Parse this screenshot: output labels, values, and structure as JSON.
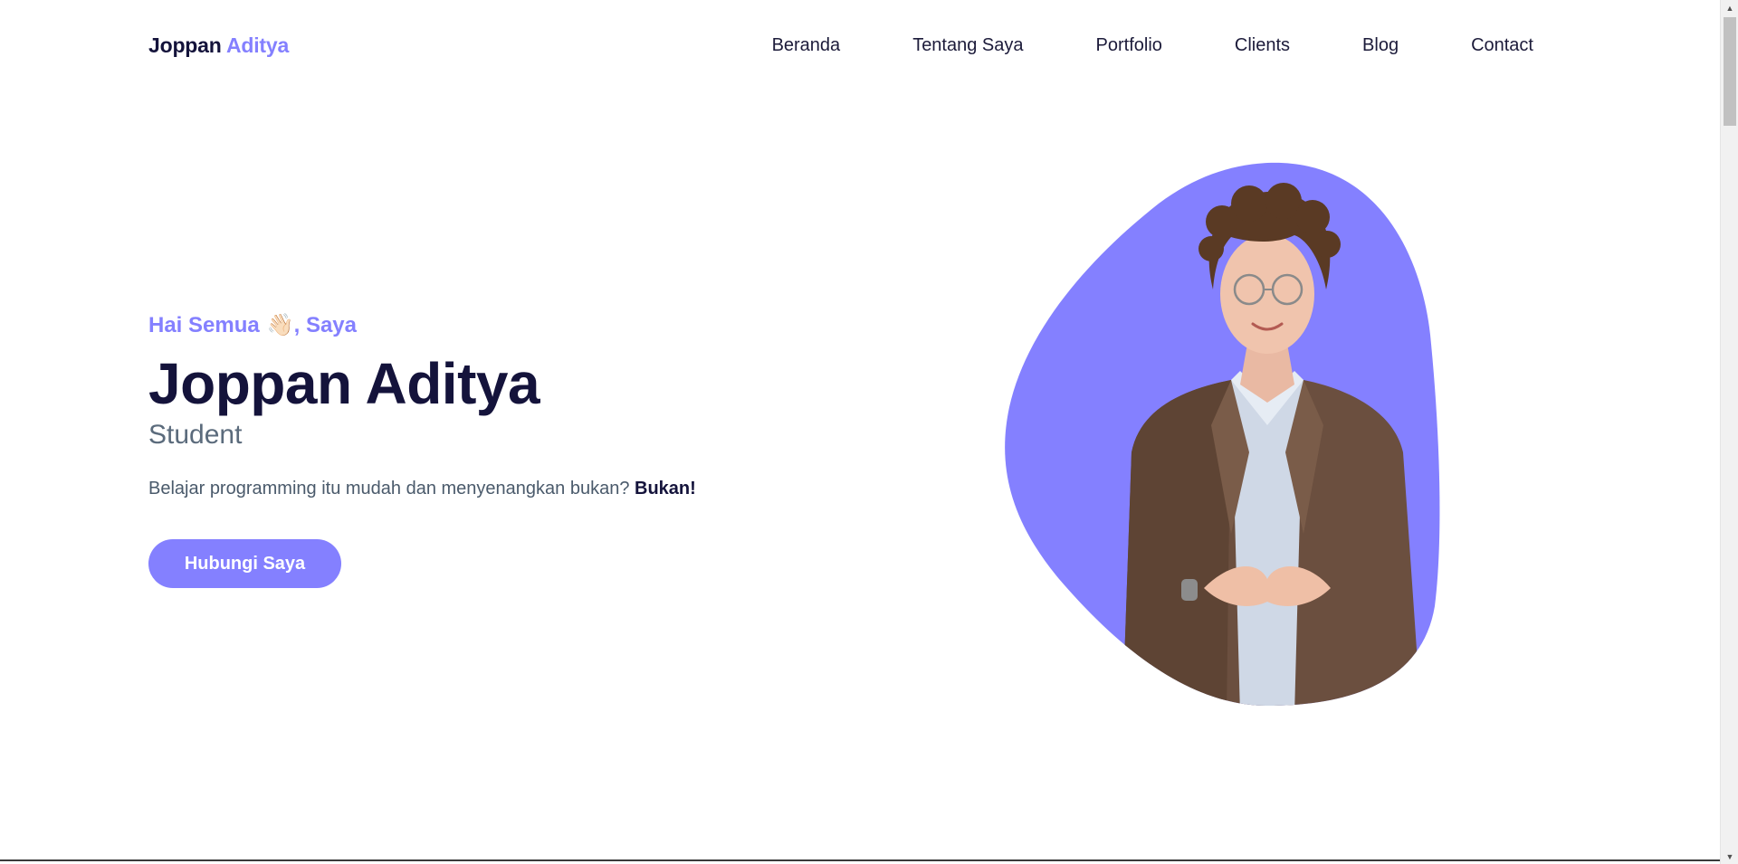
{
  "navbar": {
    "brand_first": "Joppan",
    "brand_second": "Aditya",
    "links": [
      "Beranda",
      "Tentang Saya",
      "Portfolio",
      "Clients",
      "Blog",
      "Contact"
    ]
  },
  "hero": {
    "greeting_pre": "Hai Semua",
    "wave_emoji": "👋🏻",
    "greeting_post": ", Saya",
    "name": "Joppan Aditya",
    "role": "Student",
    "description": "Belajar programming itu mudah dan menyenangkan bukan?",
    "description_emphasis": "Bukan!",
    "cta_label": "Hubungi Saya"
  },
  "colors": {
    "accent": "#8480ff",
    "heading": "#14133b",
    "muted": "#5b6b7c"
  },
  "icons": {
    "wave": "waving-hand-icon",
    "scroll_up": "scroll-up-arrow-icon",
    "scroll_down": "scroll-down-arrow-icon"
  }
}
